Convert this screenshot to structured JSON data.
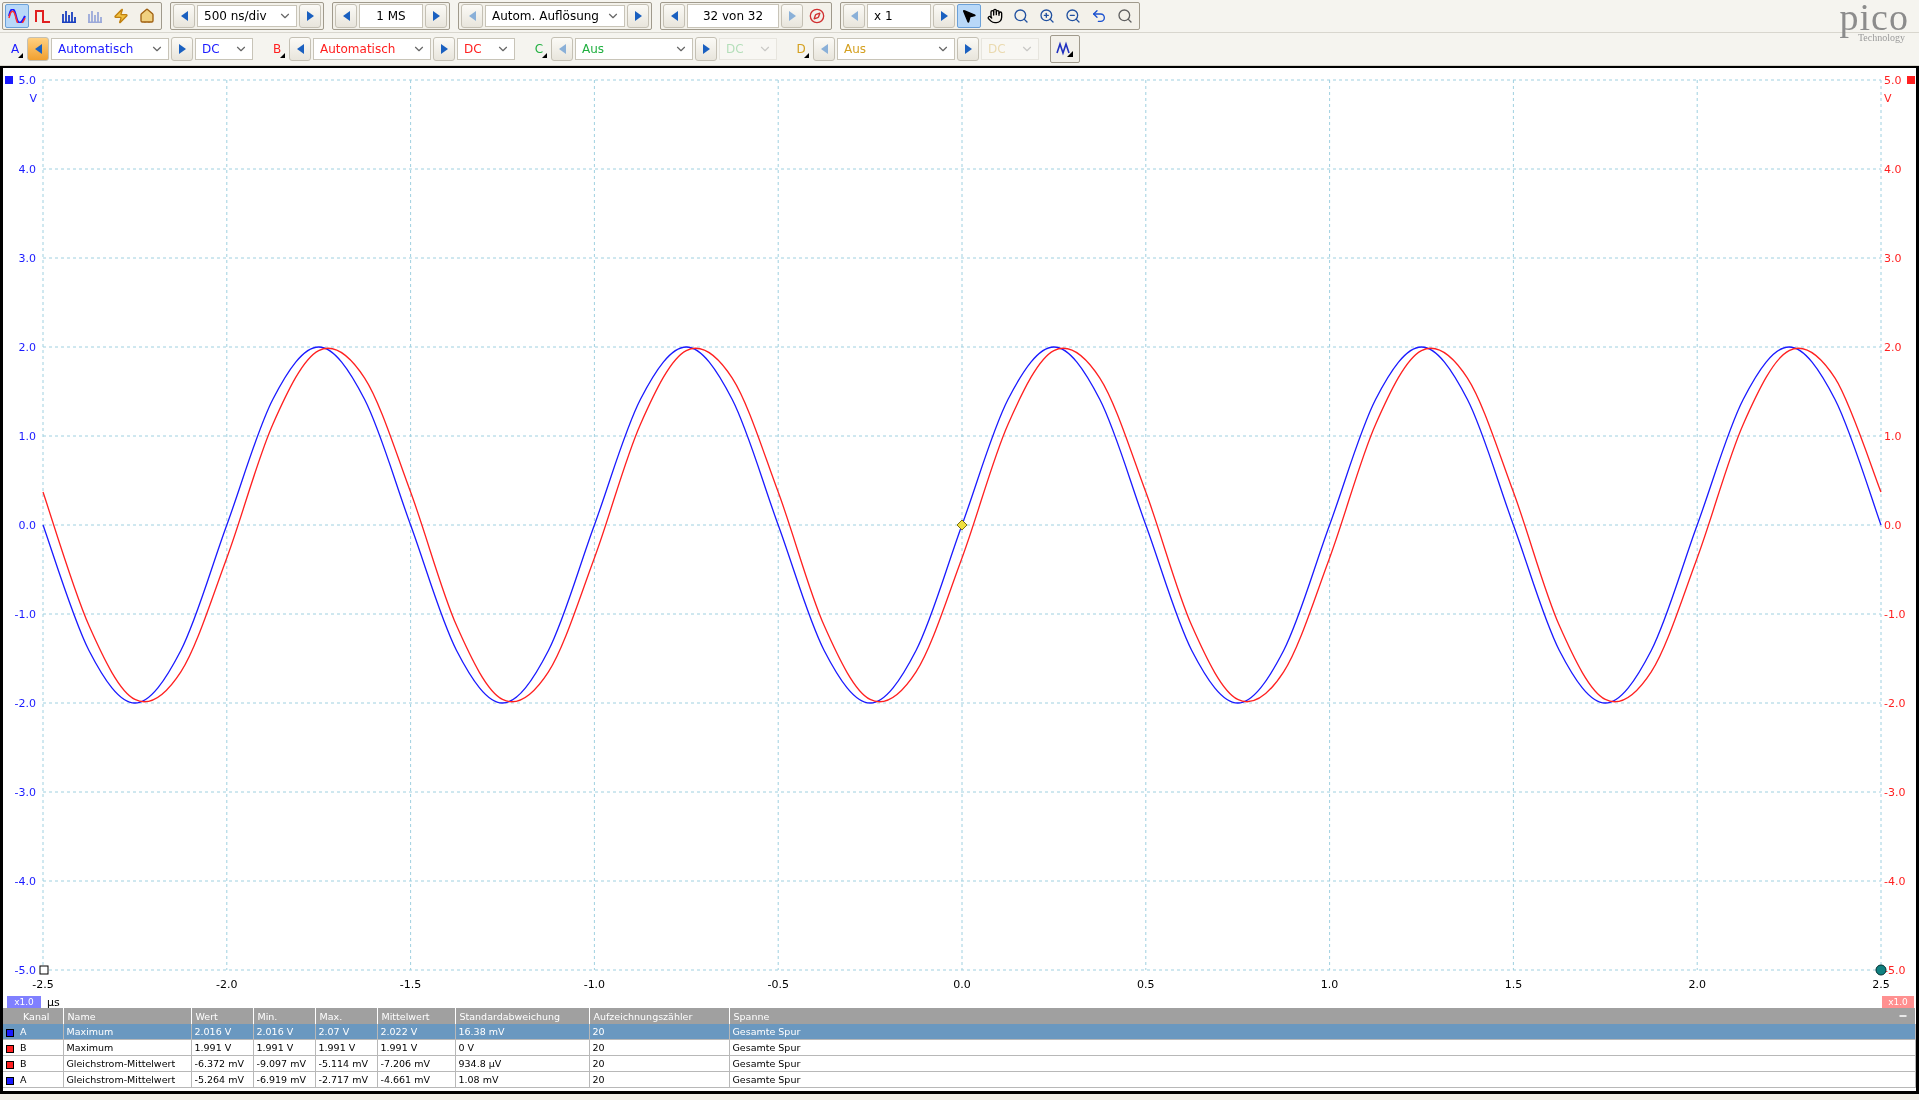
{
  "toolbar": {
    "view_modes": [
      {
        "kind": "scope",
        "selected": true,
        "disabled": false
      },
      {
        "kind": "persistence",
        "selected": false,
        "disabled": false
      },
      {
        "kind": "spectrum",
        "selected": false,
        "disabled": false
      },
      {
        "kind": "spectrum",
        "selected": false,
        "disabled": true
      },
      {
        "kind": "trigger",
        "selected": false,
        "disabled": false
      },
      {
        "kind": "home",
        "selected": false,
        "disabled": false
      }
    ],
    "timebase": "500 ns/div",
    "samples": "1 MS",
    "resolution": "Autom. Auflösung",
    "buffer": "32 von 32",
    "zoom": "x 1",
    "tools": [
      {
        "kind": "pointer",
        "selected": true
      },
      {
        "kind": "hand",
        "selected": false
      },
      {
        "kind": "zoom_area",
        "selected": false
      },
      {
        "kind": "zoom_in",
        "selected": false
      },
      {
        "kind": "zoom_out",
        "selected": false
      },
      {
        "kind": "undo",
        "selected": false
      },
      {
        "kind": "zoom_fit",
        "selected": false
      }
    ]
  },
  "logo": {
    "name": "pico",
    "tagline": "Technology"
  },
  "channels": [
    {
      "name": "A",
      "color": "#1a1aff",
      "range": "Automatisch",
      "coupling": "DC",
      "enabled": true,
      "focused": true
    },
    {
      "name": "B",
      "color": "#ff2020",
      "range": "Automatisch",
      "coupling": "DC",
      "enabled": true,
      "focused": false
    },
    {
      "name": "C",
      "color": "#20b040",
      "range": "Aus",
      "coupling": "DC",
      "enabled": false,
      "focused": false
    },
    {
      "name": "D",
      "color": "#d4a020",
      "range": "Aus",
      "coupling": "DC",
      "enabled": false,
      "focused": false
    }
  ],
  "plot": {
    "left_unit": "V",
    "right_unit": "V",
    "x_unit": "µs",
    "left_scale": "x1.0",
    "right_scale": "x1.0",
    "right_ticks": [
      "5.0",
      "4.0",
      "3.0",
      "2.0",
      "1.0",
      "0.0",
      "-1.0",
      "-2.0",
      "-3.0",
      "-4.0",
      "-5.0"
    ],
    "chart_data": {
      "type": "line",
      "xlim": [
        -2.5,
        2.5
      ],
      "ylim": [
        -5,
        5
      ],
      "x": [
        -2.5,
        -2.375,
        -2.25,
        -2.125,
        -2,
        -1.875,
        -1.75,
        -1.625,
        -1.5,
        -1.375,
        -1.25,
        -1.125,
        -1,
        -0.875,
        -0.75,
        -0.625,
        -0.5,
        -0.375,
        -0.25,
        -0.125,
        0,
        0.125,
        0.25,
        0.375,
        0.5,
        0.625,
        0.75,
        0.875,
        1,
        1.125,
        1.25,
        1.375,
        1.5,
        1.625,
        1.75,
        1.875,
        2,
        2.125,
        2.25,
        2.375,
        2.5
      ],
      "grid": true,
      "series": [
        {
          "color": "#1a1aff",
          "values": [
            0,
            -1.41,
            -2,
            -1.41,
            0,
            1.41,
            2,
            1.41,
            0,
            -1.41,
            -2,
            -1.41,
            0,
            1.41,
            2,
            1.41,
            0,
            -1.41,
            -2,
            -1.41,
            0,
            1.41,
            2,
            1.41,
            0,
            -1.41,
            -2,
            -1.41,
            0,
            1.41,
            2,
            1.41,
            0,
            -1.41,
            -2,
            -1.41,
            0,
            1.41,
            2,
            1.41,
            0
          ]
        },
        {
          "color": "#ff2020",
          "values": [
            0.37,
            -1.13,
            -1.96,
            -1.65,
            -0.37,
            1.13,
            1.96,
            1.65,
            0.37,
            -1.13,
            -1.96,
            -1.65,
            -0.37,
            1.13,
            1.96,
            1.65,
            0.37,
            -1.13,
            -1.96,
            -1.65,
            -0.37,
            1.13,
            1.96,
            1.65,
            0.37,
            -1.13,
            -1.96,
            -1.65,
            -0.37,
            1.13,
            1.96,
            1.65,
            0.37,
            -1.13,
            -1.96,
            -1.65,
            -0.37,
            1.13,
            1.96,
            1.65,
            0.37
          ]
        }
      ],
      "xticks": [
        {
          "value": -2.5,
          "label": "-2.5"
        },
        {
          "value": -2,
          "label": "-2.0"
        },
        {
          "value": -1.5,
          "label": "-1.5"
        },
        {
          "value": -1,
          "label": "-1.0"
        },
        {
          "value": -0.5,
          "label": "-0.5"
        },
        {
          "value": 0,
          "label": "0.0"
        },
        {
          "value": 0.5,
          "label": "0.5"
        },
        {
          "value": 1,
          "label": "1.0"
        },
        {
          "value": 1.5,
          "label": "1.5"
        },
        {
          "value": 2,
          "label": "2.0"
        },
        {
          "value": 2.5,
          "label": "2.5"
        }
      ],
      "yticks": [
        {
          "value": 5,
          "label": "5.0"
        },
        {
          "value": 4,
          "label": "4.0"
        },
        {
          "value": 3,
          "label": "3.0"
        },
        {
          "value": 2,
          "label": "2.0"
        },
        {
          "value": 1,
          "label": "1.0"
        },
        {
          "value": 0,
          "label": "0.0"
        },
        {
          "value": -1,
          "label": "-1.0"
        },
        {
          "value": -2,
          "label": "-2.0"
        },
        {
          "value": -3,
          "label": "-3.0"
        },
        {
          "value": -4,
          "label": "-4.0"
        },
        {
          "value": -5,
          "label": "-5.0"
        }
      ]
    }
  },
  "measurements": {
    "columns": [
      "Kanal",
      "Name",
      "Wert",
      "Min.",
      "Max.",
      "Mittelwert",
      "Standardabweichung",
      "Aufzeichnungszähler",
      "Spanne"
    ],
    "rows": [
      {
        "color": "#1a1aff",
        "selected": true,
        "cells": [
          "A",
          "Maximum",
          "2.016 V",
          "2.016 V",
          "2.07 V",
          "2.022 V",
          "16.38 mV",
          "20",
          "Gesamte Spur"
        ]
      },
      {
        "color": "#ff2020",
        "selected": false,
        "cells": [
          "B",
          "Maximum",
          "1.991 V",
          "1.991 V",
          "1.991 V",
          "1.991 V",
          "0 V",
          "20",
          "Gesamte Spur"
        ]
      },
      {
        "color": "#ff2020",
        "selected": false,
        "cells": [
          "B",
          "Gleichstrom-Mittelwert",
          "-6.372 mV",
          "-9.097 mV",
          "-5.114 mV",
          "-7.206 mV",
          "934.8 µV",
          "20",
          "Gesamte Spur"
        ]
      },
      {
        "color": "#1a1aff",
        "selected": false,
        "cells": [
          "A",
          "Gleichstrom-Mittelwert",
          "-5.264 mV",
          "-6.919 mV",
          "-2.717 mV",
          "-4.661 mV",
          "1.08 mV",
          "20",
          "Gesamte Spur"
        ]
      }
    ]
  }
}
